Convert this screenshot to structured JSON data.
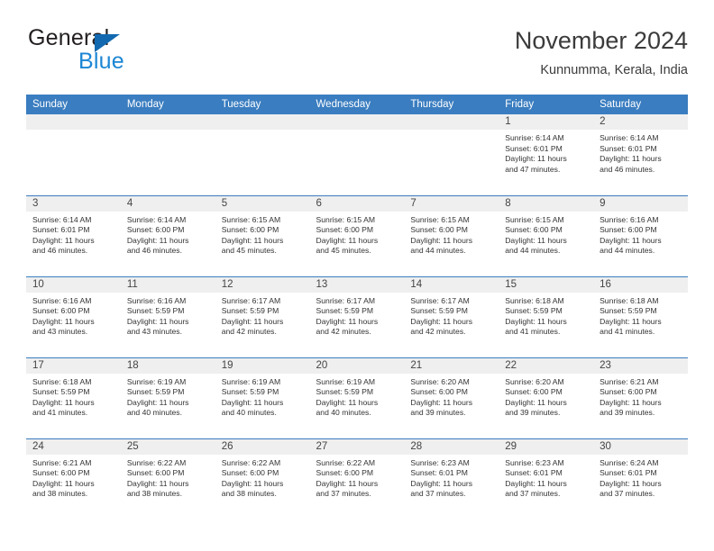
{
  "logo": {
    "line1": "General",
    "line2": "Blue",
    "triangle_icon": "blue-triangle-icon",
    "brand_blue": "#1c86d4",
    "triangle_blue": "#1269b0"
  },
  "header": {
    "title": "November 2024",
    "subtitle": "Kunnumma, Kerala, India"
  },
  "colors": {
    "header_blue": "#3a7dc0",
    "date_band": "#efefef",
    "text": "#333333"
  },
  "weekdays": [
    "Sunday",
    "Monday",
    "Tuesday",
    "Wednesday",
    "Thursday",
    "Friday",
    "Saturday"
  ],
  "weeks": [
    [
      {
        "date": "",
        "sunrise": "",
        "sunset": "",
        "daylight1": "",
        "daylight2": ""
      },
      {
        "date": "",
        "sunrise": "",
        "sunset": "",
        "daylight1": "",
        "daylight2": ""
      },
      {
        "date": "",
        "sunrise": "",
        "sunset": "",
        "daylight1": "",
        "daylight2": ""
      },
      {
        "date": "",
        "sunrise": "",
        "sunset": "",
        "daylight1": "",
        "daylight2": ""
      },
      {
        "date": "",
        "sunrise": "",
        "sunset": "",
        "daylight1": "",
        "daylight2": ""
      },
      {
        "date": "1",
        "sunrise": "Sunrise: 6:14 AM",
        "sunset": "Sunset: 6:01 PM",
        "daylight1": "Daylight: 11 hours",
        "daylight2": "and 47 minutes."
      },
      {
        "date": "2",
        "sunrise": "Sunrise: 6:14 AM",
        "sunset": "Sunset: 6:01 PM",
        "daylight1": "Daylight: 11 hours",
        "daylight2": "and 46 minutes."
      }
    ],
    [
      {
        "date": "3",
        "sunrise": "Sunrise: 6:14 AM",
        "sunset": "Sunset: 6:01 PM",
        "daylight1": "Daylight: 11 hours",
        "daylight2": "and 46 minutes."
      },
      {
        "date": "4",
        "sunrise": "Sunrise: 6:14 AM",
        "sunset": "Sunset: 6:00 PM",
        "daylight1": "Daylight: 11 hours",
        "daylight2": "and 46 minutes."
      },
      {
        "date": "5",
        "sunrise": "Sunrise: 6:15 AM",
        "sunset": "Sunset: 6:00 PM",
        "daylight1": "Daylight: 11 hours",
        "daylight2": "and 45 minutes."
      },
      {
        "date": "6",
        "sunrise": "Sunrise: 6:15 AM",
        "sunset": "Sunset: 6:00 PM",
        "daylight1": "Daylight: 11 hours",
        "daylight2": "and 45 minutes."
      },
      {
        "date": "7",
        "sunrise": "Sunrise: 6:15 AM",
        "sunset": "Sunset: 6:00 PM",
        "daylight1": "Daylight: 11 hours",
        "daylight2": "and 44 minutes."
      },
      {
        "date": "8",
        "sunrise": "Sunrise: 6:15 AM",
        "sunset": "Sunset: 6:00 PM",
        "daylight1": "Daylight: 11 hours",
        "daylight2": "and 44 minutes."
      },
      {
        "date": "9",
        "sunrise": "Sunrise: 6:16 AM",
        "sunset": "Sunset: 6:00 PM",
        "daylight1": "Daylight: 11 hours",
        "daylight2": "and 44 minutes."
      }
    ],
    [
      {
        "date": "10",
        "sunrise": "Sunrise: 6:16 AM",
        "sunset": "Sunset: 6:00 PM",
        "daylight1": "Daylight: 11 hours",
        "daylight2": "and 43 minutes."
      },
      {
        "date": "11",
        "sunrise": "Sunrise: 6:16 AM",
        "sunset": "Sunset: 5:59 PM",
        "daylight1": "Daylight: 11 hours",
        "daylight2": "and 43 minutes."
      },
      {
        "date": "12",
        "sunrise": "Sunrise: 6:17 AM",
        "sunset": "Sunset: 5:59 PM",
        "daylight1": "Daylight: 11 hours",
        "daylight2": "and 42 minutes."
      },
      {
        "date": "13",
        "sunrise": "Sunrise: 6:17 AM",
        "sunset": "Sunset: 5:59 PM",
        "daylight1": "Daylight: 11 hours",
        "daylight2": "and 42 minutes."
      },
      {
        "date": "14",
        "sunrise": "Sunrise: 6:17 AM",
        "sunset": "Sunset: 5:59 PM",
        "daylight1": "Daylight: 11 hours",
        "daylight2": "and 42 minutes."
      },
      {
        "date": "15",
        "sunrise": "Sunrise: 6:18 AM",
        "sunset": "Sunset: 5:59 PM",
        "daylight1": "Daylight: 11 hours",
        "daylight2": "and 41 minutes."
      },
      {
        "date": "16",
        "sunrise": "Sunrise: 6:18 AM",
        "sunset": "Sunset: 5:59 PM",
        "daylight1": "Daylight: 11 hours",
        "daylight2": "and 41 minutes."
      }
    ],
    [
      {
        "date": "17",
        "sunrise": "Sunrise: 6:18 AM",
        "sunset": "Sunset: 5:59 PM",
        "daylight1": "Daylight: 11 hours",
        "daylight2": "and 41 minutes."
      },
      {
        "date": "18",
        "sunrise": "Sunrise: 6:19 AM",
        "sunset": "Sunset: 5:59 PM",
        "daylight1": "Daylight: 11 hours",
        "daylight2": "and 40 minutes."
      },
      {
        "date": "19",
        "sunrise": "Sunrise: 6:19 AM",
        "sunset": "Sunset: 5:59 PM",
        "daylight1": "Daylight: 11 hours",
        "daylight2": "and 40 minutes."
      },
      {
        "date": "20",
        "sunrise": "Sunrise: 6:19 AM",
        "sunset": "Sunset: 5:59 PM",
        "daylight1": "Daylight: 11 hours",
        "daylight2": "and 40 minutes."
      },
      {
        "date": "21",
        "sunrise": "Sunrise: 6:20 AM",
        "sunset": "Sunset: 6:00 PM",
        "daylight1": "Daylight: 11 hours",
        "daylight2": "and 39 minutes."
      },
      {
        "date": "22",
        "sunrise": "Sunrise: 6:20 AM",
        "sunset": "Sunset: 6:00 PM",
        "daylight1": "Daylight: 11 hours",
        "daylight2": "and 39 minutes."
      },
      {
        "date": "23",
        "sunrise": "Sunrise: 6:21 AM",
        "sunset": "Sunset: 6:00 PM",
        "daylight1": "Daylight: 11 hours",
        "daylight2": "and 39 minutes."
      }
    ],
    [
      {
        "date": "24",
        "sunrise": "Sunrise: 6:21 AM",
        "sunset": "Sunset: 6:00 PM",
        "daylight1": "Daylight: 11 hours",
        "daylight2": "and 38 minutes."
      },
      {
        "date": "25",
        "sunrise": "Sunrise: 6:22 AM",
        "sunset": "Sunset: 6:00 PM",
        "daylight1": "Daylight: 11 hours",
        "daylight2": "and 38 minutes."
      },
      {
        "date": "26",
        "sunrise": "Sunrise: 6:22 AM",
        "sunset": "Sunset: 6:00 PM",
        "daylight1": "Daylight: 11 hours",
        "daylight2": "and 38 minutes."
      },
      {
        "date": "27",
        "sunrise": "Sunrise: 6:22 AM",
        "sunset": "Sunset: 6:00 PM",
        "daylight1": "Daylight: 11 hours",
        "daylight2": "and 37 minutes."
      },
      {
        "date": "28",
        "sunrise": "Sunrise: 6:23 AM",
        "sunset": "Sunset: 6:01 PM",
        "daylight1": "Daylight: 11 hours",
        "daylight2": "and 37 minutes."
      },
      {
        "date": "29",
        "sunrise": "Sunrise: 6:23 AM",
        "sunset": "Sunset: 6:01 PM",
        "daylight1": "Daylight: 11 hours",
        "daylight2": "and 37 minutes."
      },
      {
        "date": "30",
        "sunrise": "Sunrise: 6:24 AM",
        "sunset": "Sunset: 6:01 PM",
        "daylight1": "Daylight: 11 hours",
        "daylight2": "and 37 minutes."
      }
    ]
  ]
}
